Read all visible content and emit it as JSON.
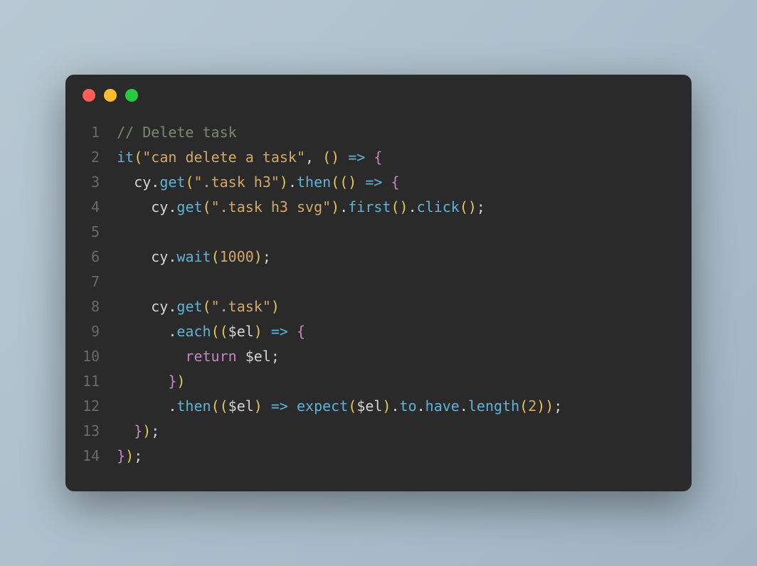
{
  "window": {
    "traffic_lights": [
      "close",
      "minimize",
      "zoom"
    ]
  },
  "code": {
    "line_numbers": [
      "1",
      "2",
      "3",
      "4",
      "5",
      "6",
      "7",
      "8",
      "9",
      "10",
      "11",
      "12",
      "13",
      "14"
    ],
    "lines": [
      [
        {
          "t": "// Delete task",
          "c": "comment"
        }
      ],
      [
        {
          "t": "it",
          "c": "func"
        },
        {
          "t": "(",
          "c": "paren"
        },
        {
          "t": "\"can delete a task\"",
          "c": "string"
        },
        {
          "t": ", ",
          "c": "punct"
        },
        {
          "t": "(",
          "c": "paren"
        },
        {
          "t": ")",
          "c": "paren"
        },
        {
          "t": " ",
          "c": "punct"
        },
        {
          "t": "=>",
          "c": "arrow"
        },
        {
          "t": " ",
          "c": "punct"
        },
        {
          "t": "{",
          "c": "brace"
        }
      ],
      [
        {
          "t": "  ",
          "c": "punct"
        },
        {
          "t": "cy",
          "c": "ident"
        },
        {
          "t": ".",
          "c": "dot"
        },
        {
          "t": "get",
          "c": "prop"
        },
        {
          "t": "(",
          "c": "paren"
        },
        {
          "t": "\".task h3\"",
          "c": "string"
        },
        {
          "t": ")",
          "c": "paren"
        },
        {
          "t": ".",
          "c": "dot"
        },
        {
          "t": "then",
          "c": "prop"
        },
        {
          "t": "(",
          "c": "paren"
        },
        {
          "t": "(",
          "c": "paren"
        },
        {
          "t": ")",
          "c": "paren"
        },
        {
          "t": " ",
          "c": "punct"
        },
        {
          "t": "=>",
          "c": "arrow"
        },
        {
          "t": " ",
          "c": "punct"
        },
        {
          "t": "{",
          "c": "brace"
        }
      ],
      [
        {
          "t": "    ",
          "c": "punct"
        },
        {
          "t": "cy",
          "c": "ident"
        },
        {
          "t": ".",
          "c": "dot"
        },
        {
          "t": "get",
          "c": "prop"
        },
        {
          "t": "(",
          "c": "paren"
        },
        {
          "t": "\".task h3 svg\"",
          "c": "string"
        },
        {
          "t": ")",
          "c": "paren"
        },
        {
          "t": ".",
          "c": "dot"
        },
        {
          "t": "first",
          "c": "prop"
        },
        {
          "t": "(",
          "c": "paren"
        },
        {
          "t": ")",
          "c": "paren"
        },
        {
          "t": ".",
          "c": "dot"
        },
        {
          "t": "click",
          "c": "prop"
        },
        {
          "t": "(",
          "c": "paren"
        },
        {
          "t": ")",
          "c": "paren"
        },
        {
          "t": ";",
          "c": "punct"
        }
      ],
      [
        {
          "t": "",
          "c": "punct"
        }
      ],
      [
        {
          "t": "    ",
          "c": "punct"
        },
        {
          "t": "cy",
          "c": "ident"
        },
        {
          "t": ".",
          "c": "dot"
        },
        {
          "t": "wait",
          "c": "prop"
        },
        {
          "t": "(",
          "c": "paren"
        },
        {
          "t": "1000",
          "c": "num"
        },
        {
          "t": ")",
          "c": "paren"
        },
        {
          "t": ";",
          "c": "punct"
        }
      ],
      [
        {
          "t": "",
          "c": "punct"
        }
      ],
      [
        {
          "t": "    ",
          "c": "punct"
        },
        {
          "t": "cy",
          "c": "ident"
        },
        {
          "t": ".",
          "c": "dot"
        },
        {
          "t": "get",
          "c": "prop"
        },
        {
          "t": "(",
          "c": "paren"
        },
        {
          "t": "\".task\"",
          "c": "string"
        },
        {
          "t": ")",
          "c": "paren"
        }
      ],
      [
        {
          "t": "      ",
          "c": "punct"
        },
        {
          "t": ".",
          "c": "dot"
        },
        {
          "t": "each",
          "c": "prop"
        },
        {
          "t": "(",
          "c": "paren"
        },
        {
          "t": "(",
          "c": "paren"
        },
        {
          "t": "$el",
          "c": "ident"
        },
        {
          "t": ")",
          "c": "paren"
        },
        {
          "t": " ",
          "c": "punct"
        },
        {
          "t": "=>",
          "c": "arrow"
        },
        {
          "t": " ",
          "c": "punct"
        },
        {
          "t": "{",
          "c": "brace"
        }
      ],
      [
        {
          "t": "        ",
          "c": "punct"
        },
        {
          "t": "return",
          "c": "kw"
        },
        {
          "t": " ",
          "c": "punct"
        },
        {
          "t": "$el",
          "c": "ident"
        },
        {
          "t": ";",
          "c": "punct"
        }
      ],
      [
        {
          "t": "      ",
          "c": "punct"
        },
        {
          "t": "}",
          "c": "brace"
        },
        {
          "t": ")",
          "c": "paren"
        }
      ],
      [
        {
          "t": "      ",
          "c": "punct"
        },
        {
          "t": ".",
          "c": "dot"
        },
        {
          "t": "then",
          "c": "prop"
        },
        {
          "t": "(",
          "c": "paren"
        },
        {
          "t": "(",
          "c": "paren"
        },
        {
          "t": "$el",
          "c": "ident"
        },
        {
          "t": ")",
          "c": "paren"
        },
        {
          "t": " ",
          "c": "punct"
        },
        {
          "t": "=>",
          "c": "arrow"
        },
        {
          "t": " ",
          "c": "punct"
        },
        {
          "t": "expect",
          "c": "func"
        },
        {
          "t": "(",
          "c": "paren"
        },
        {
          "t": "$el",
          "c": "ident"
        },
        {
          "t": ")",
          "c": "paren"
        },
        {
          "t": ".",
          "c": "dot"
        },
        {
          "t": "to",
          "c": "prop"
        },
        {
          "t": ".",
          "c": "dot"
        },
        {
          "t": "have",
          "c": "prop"
        },
        {
          "t": ".",
          "c": "dot"
        },
        {
          "t": "length",
          "c": "prop"
        },
        {
          "t": "(",
          "c": "paren"
        },
        {
          "t": "2",
          "c": "num"
        },
        {
          "t": ")",
          "c": "paren"
        },
        {
          "t": ")",
          "c": "paren"
        },
        {
          "t": ";",
          "c": "punct"
        }
      ],
      [
        {
          "t": "  ",
          "c": "punct"
        },
        {
          "t": "}",
          "c": "brace"
        },
        {
          "t": ")",
          "c": "paren"
        },
        {
          "t": ";",
          "c": "punct"
        }
      ],
      [
        {
          "t": "}",
          "c": "brace"
        },
        {
          "t": ")",
          "c": "paren"
        },
        {
          "t": ";",
          "c": "punct"
        }
      ]
    ]
  }
}
